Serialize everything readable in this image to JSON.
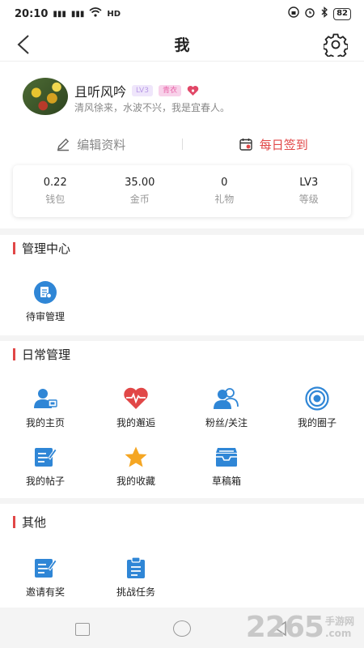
{
  "status_bar": {
    "time": "20:10",
    "network_label": "HD",
    "battery": "82"
  },
  "header": {
    "title": "我"
  },
  "profile": {
    "username": "且听风吟",
    "level_tag": "LV3",
    "rank_tag": "青衣",
    "bio": "清风徐来，水波不兴，我是宜春人。",
    "edit_label": "编辑资料",
    "sign_in_label": "每日签到"
  },
  "stats": [
    {
      "value": "0.22",
      "label": "钱包"
    },
    {
      "value": "35.00",
      "label": "金币"
    },
    {
      "value": "0",
      "label": "礼物"
    },
    {
      "value": "LV3",
      "label": "等级"
    }
  ],
  "sections": {
    "management": {
      "title": "管理中心",
      "items": [
        {
          "label": "待审管理",
          "icon": "review-icon"
        }
      ]
    },
    "daily": {
      "title": "日常管理",
      "items": [
        {
          "label": "我的主页",
          "icon": "user-home-icon"
        },
        {
          "label": "我的邂逅",
          "icon": "heart-pulse-icon"
        },
        {
          "label": "粉丝/关注",
          "icon": "followers-icon"
        },
        {
          "label": "我的圈子",
          "icon": "circle-icon"
        },
        {
          "label": "我的帖子",
          "icon": "post-icon"
        },
        {
          "label": "我的收藏",
          "icon": "star-icon"
        },
        {
          "label": "草稿箱",
          "icon": "draft-box-icon"
        }
      ]
    },
    "other": {
      "title": "其他",
      "items": [
        {
          "label": "邀请有奖",
          "icon": "invite-icon"
        },
        {
          "label": "挑战任务",
          "icon": "task-clipboard-icon"
        }
      ]
    }
  },
  "watermark": {
    "big": "2265",
    "small_top": "手游网",
    "small_bottom": ".com"
  },
  "colors": {
    "accent_red": "#e14747",
    "icon_blue": "#2f86d6"
  }
}
